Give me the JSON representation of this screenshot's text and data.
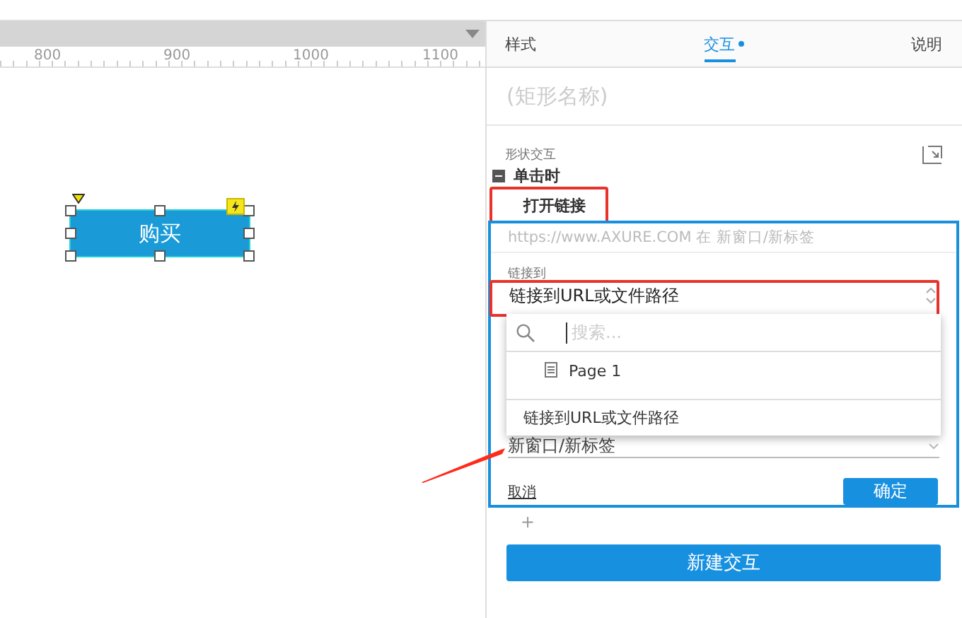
{
  "canvas": {
    "ruler_marks": [
      "800",
      "900",
      "1000",
      "1100"
    ],
    "widget": {
      "label": "购买",
      "selected": true,
      "has_interaction": true
    }
  },
  "panel": {
    "tabs": [
      {
        "label": "样式",
        "selected": false,
        "modified": false
      },
      {
        "label": "交互",
        "selected": true,
        "modified": true
      },
      {
        "label": "说明",
        "selected": false,
        "modified": false
      }
    ],
    "name_placeholder": "(矩形名称)",
    "section_title": "形状交互",
    "event": {
      "label": "单击时",
      "expanded": true,
      "actions": [
        {
          "label": "打开链接",
          "highlighted": true
        }
      ]
    },
    "editor": {
      "summary": "https://www.AXURE.COM 在 新窗口/新标签",
      "link_label": "链接到",
      "link_value": "链接到URL或文件路径",
      "link_highlighted": true,
      "dropdown": {
        "search_placeholder": "搜索...",
        "items": [
          {
            "label": "Page 1",
            "kind": "page"
          },
          {
            "label": "链接到URL或文件路径",
            "kind": "url"
          }
        ]
      },
      "target_value": "新窗口/新标签",
      "cancel": "取消",
      "confirm": "确定"
    },
    "add": "+",
    "new_button": "新建交互"
  }
}
